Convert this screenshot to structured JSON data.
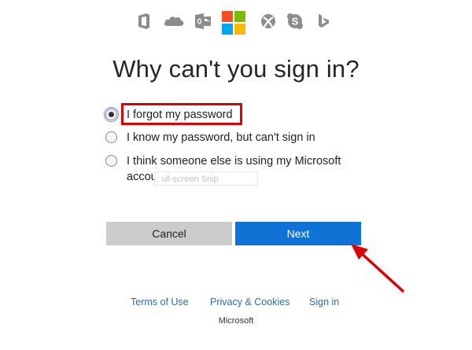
{
  "header": {
    "icons": [
      "office-icon",
      "onedrive-icon",
      "outlook-icon",
      "microsoft-logo",
      "xbox-icon",
      "skype-icon",
      "bing-icon"
    ],
    "logo_colors": [
      "#f25022",
      "#7fba00",
      "#00a4ef",
      "#ffb900"
    ]
  },
  "page": {
    "title": "Why can't you sign in?"
  },
  "options": [
    {
      "label": "I forgot my password",
      "checked": true
    },
    {
      "label": "I know my password, but can't sign in",
      "checked": false
    },
    {
      "label": "I think someone else is using my Microsoft",
      "label_line2": "account",
      "checked": false
    }
  ],
  "overlay": {
    "snip_text": "ull-screen Snip"
  },
  "buttons": {
    "cancel": "Cancel",
    "next": "Next"
  },
  "footer": {
    "terms": "Terms of Use",
    "privacy": "Privacy & Cookies",
    "signin": "Sign in",
    "brand": "Microsoft"
  },
  "annotation": {
    "color": "#e00000"
  }
}
